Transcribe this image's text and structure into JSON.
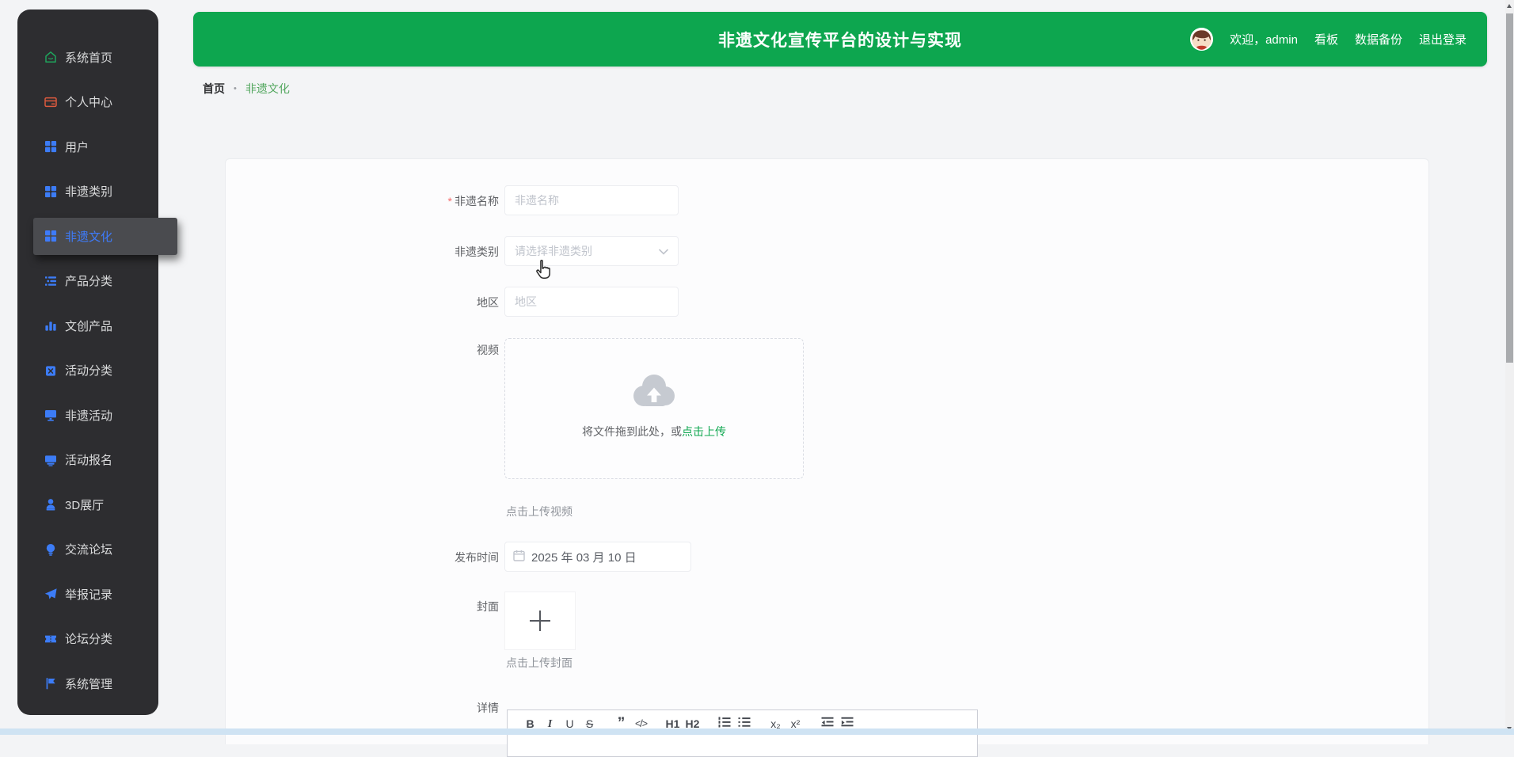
{
  "header": {
    "title": "非遗文化宣传平台的设计与实现",
    "welcome": "欢迎，admin",
    "links": [
      {
        "label": "看板"
      },
      {
        "label": "数据备份"
      },
      {
        "label": "退出登录"
      }
    ]
  },
  "breadcrumb": {
    "home": "首页",
    "separator": "•",
    "current": "非遗文化"
  },
  "sidebar": {
    "items": [
      {
        "label": "系统首页"
      },
      {
        "label": "个人中心"
      },
      {
        "label": "用户"
      },
      {
        "label": "非遗类别"
      },
      {
        "label": "非遗文化"
      },
      {
        "label": "产品分类"
      },
      {
        "label": "文创产品"
      },
      {
        "label": "活动分类"
      },
      {
        "label": "非遗活动"
      },
      {
        "label": "活动报名"
      },
      {
        "label": "3D展厅"
      },
      {
        "label": "交流论坛"
      },
      {
        "label": "举报记录"
      },
      {
        "label": "论坛分类"
      },
      {
        "label": "系统管理"
      }
    ]
  },
  "form": {
    "name": {
      "required_mark": "*",
      "label": "非遗名称",
      "placeholder": "非遗名称"
    },
    "category": {
      "label": "非遗类别",
      "placeholder": "请选择非遗类别"
    },
    "region": {
      "label": "地区",
      "placeholder": "地区"
    },
    "video": {
      "label": "视频",
      "drop_text": "将文件拖到此处，或",
      "upload_link": "点击上传",
      "tip": "点击上传视频"
    },
    "publish": {
      "label": "发布时间",
      "value": "2025 年 03 月 10 日"
    },
    "cover": {
      "label": "封面",
      "tip": "点击上传封面"
    },
    "detail": {
      "label": "详情",
      "toolbar": [
        {
          "name": "bold",
          "glyph": "B"
        },
        {
          "name": "italic",
          "glyph": "I"
        },
        {
          "name": "underline",
          "glyph": "U"
        },
        {
          "name": "strikethrough",
          "glyph": "S"
        },
        {
          "name": "quote",
          "glyph": "”"
        },
        {
          "name": "code",
          "glyph": "</>"
        },
        {
          "name": "h1",
          "glyph": "H1"
        },
        {
          "name": "h2",
          "glyph": "H2"
        },
        {
          "name": "subscript",
          "glyph": "x₂"
        },
        {
          "name": "superscript",
          "glyph": "x²"
        }
      ]
    }
  },
  "colors": {
    "accent_green": "#0da64f",
    "sidebar_bg": "#2d2d30",
    "icon_blue": "#3c7cf6",
    "active_item_text": "#3e7bfa",
    "breadcrumb_current": "#53a75f",
    "required_red": "#f56c6c"
  }
}
